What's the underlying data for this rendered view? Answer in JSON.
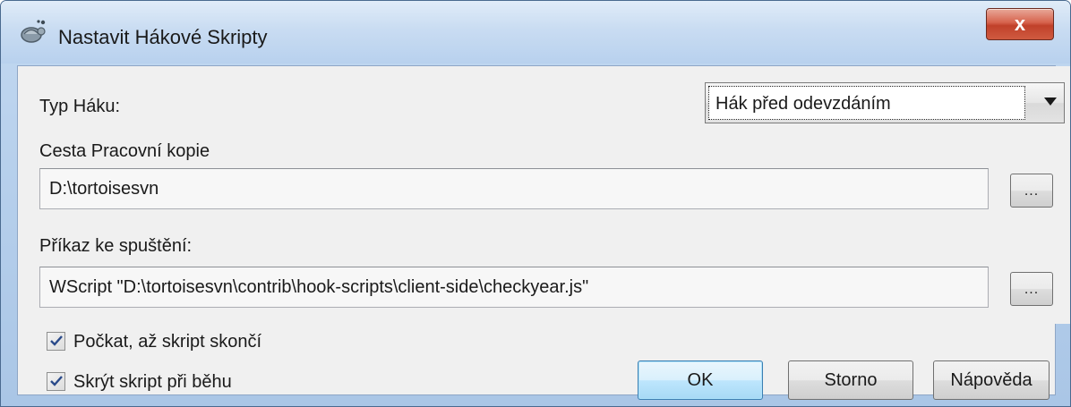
{
  "window": {
    "title": "Nastavit Hákové Skripty",
    "close_glyph": "x"
  },
  "hook_type": {
    "label": "Typ Háku:",
    "selected": "Hák před odevzdáním"
  },
  "working_copy": {
    "label": "Cesta Pracovní kopie",
    "value": "D:\\tortoisesvn",
    "browse_label": "..."
  },
  "command": {
    "label": "Příkaz ke spuštění:",
    "value": "WScript \"D:\\tortoisesvn\\contrib\\hook-scripts\\client-side\\checkyear.js\"",
    "browse_label": "..."
  },
  "options": [
    {
      "label": "Počkat, až skript skončí",
      "checked": true
    },
    {
      "label": "Skrýt skript při běhu",
      "checked": true
    }
  ],
  "buttons": {
    "ok": "OK",
    "cancel": "Storno",
    "help": "Nápověda"
  },
  "icons": {
    "title_icon": "tortoise-icon",
    "dropdown": "chevron-down-icon",
    "check": "checkmark-icon"
  }
}
